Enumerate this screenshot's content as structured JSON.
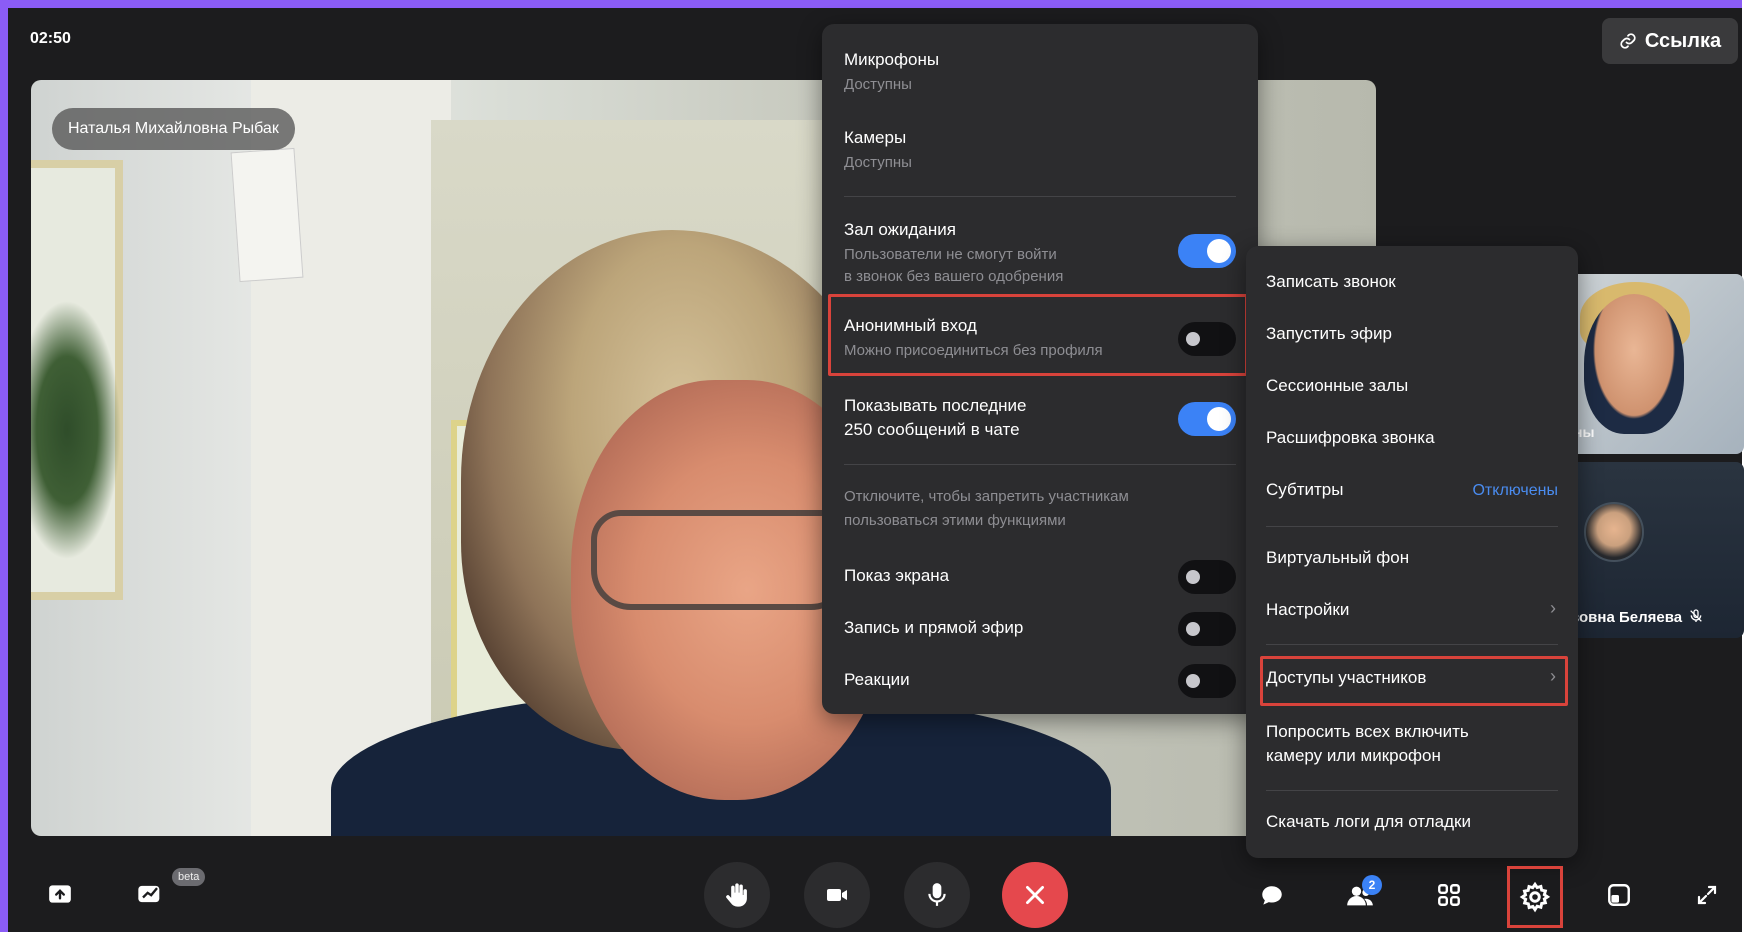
{
  "header": {
    "timer": "02:50",
    "link_button": "Ссылка"
  },
  "main_video": {
    "participant_name": "Наталья Михайловна Рыбак"
  },
  "thumbnails": [
    {
      "label": "ны"
    },
    {
      "label": "вовна Беляева"
    }
  ],
  "permissions_menu": {
    "microphones": {
      "title": "Микрофоны",
      "sub": "Доступны"
    },
    "cameras": {
      "title": "Камеры",
      "sub": "Доступны"
    },
    "waiting_room": {
      "title": "Зал ожидания",
      "sub1": "Пользователи не смогут войти",
      "sub2": "в звонок без вашего одобрения",
      "enabled": true
    },
    "anonymous_entry": {
      "title": "Анонимный вход",
      "sub": "Можно присоединиться без профиля",
      "enabled": false
    },
    "show_messages": {
      "line1": "Показывать последние",
      "line2": "250 сообщений в чате",
      "enabled": true
    },
    "hint": {
      "line1": "Отключите, чтобы запретить участникам",
      "line2": "пользоваться этими функциями"
    },
    "screen_share": {
      "title": "Показ экрана",
      "enabled": false
    },
    "record_stream": {
      "title": "Запись и прямой эфир",
      "enabled": false
    },
    "reactions": {
      "title": "Реакции",
      "enabled": false
    }
  },
  "settings_menu": {
    "record_call": "Записать звонок",
    "start_stream": "Запустить эфир",
    "session_rooms": "Сессионные залы",
    "transcription": "Расшифровка звонка",
    "subtitles": "Субтитры",
    "subtitles_status": "Отключены",
    "virtual_background": "Виртуальный фон",
    "settings": "Настройки",
    "participant_access": "Доступы участников",
    "ask_all_line1": "Попросить всех включить",
    "ask_all_line2": "камеру или микрофон",
    "download_logs": "Скачать логи для отладки"
  },
  "bottom_bar": {
    "beta_badge": "beta",
    "participants_count": "2"
  },
  "colors": {
    "accent": "#3b82f6",
    "highlight": "#d9433b",
    "end_call": "#e5484d",
    "frame": "#8b5cf6"
  }
}
